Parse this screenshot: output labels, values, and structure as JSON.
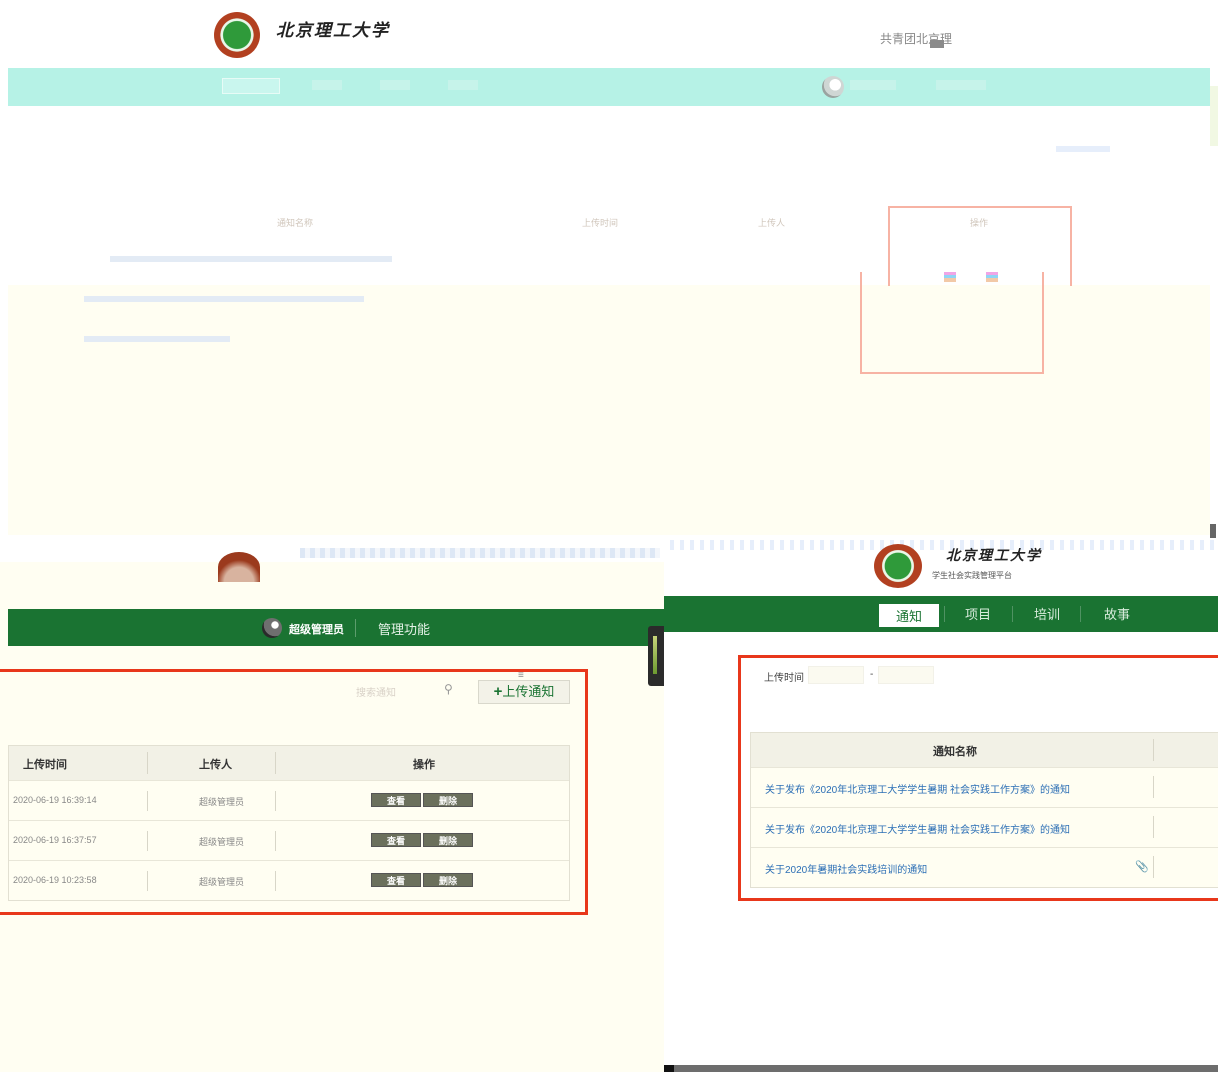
{
  "top_panel": {
    "brand_title": "北京理工大学",
    "org_text": "共青团北京理",
    "nav_items": [
      "通知",
      "项目",
      "培训",
      "故事"
    ],
    "table_headers": [
      "通知名称",
      "上传时间",
      "上传人",
      "操作"
    ]
  },
  "left_panel": {
    "user_name": "超级管理员",
    "admin_menu": "管理功能",
    "search_placeholder": "搜索通知",
    "upload_label": "上传通知",
    "table": {
      "headers": [
        "上传时间",
        "上传人",
        "操作"
      ],
      "rows": [
        {
          "time": "2020-06-19 16:39:14",
          "uploader": "超级管理员",
          "view": "查看",
          "delete": "删除"
        },
        {
          "time": "2020-06-19 16:37:57",
          "uploader": "超级管理员",
          "view": "查看",
          "delete": "删除"
        },
        {
          "time": "2020-06-19 10:23:58",
          "uploader": "超级管理员",
          "view": "查看",
          "delete": "删除"
        }
      ]
    }
  },
  "right_panel": {
    "brand_title": "北京理工大学",
    "brand_sub": "学生社会实践管理平台",
    "nav_tabs": [
      "通知",
      "项目",
      "培训",
      "故事"
    ],
    "active_tab": "通知",
    "filter_label": "上传时间",
    "date_separator": "-",
    "table_header": "通知名称",
    "rows": [
      {
        "title": "关于发布《2020年北京理工大学学生暑期 社会实践工作方案》的通知",
        "attachment": false
      },
      {
        "title": "关于发布《2020年北京理工大学学生暑期 社会实践工作方案》的通知",
        "attachment": false
      },
      {
        "title": "关于2020年暑期社会实践培训的通知",
        "attachment": true
      }
    ]
  },
  "icons": {
    "search": "search-icon",
    "attachment": "paperclip-icon",
    "add": "plus-icon"
  },
  "colors": {
    "nav_green": "#1a7332",
    "highlight_red": "#e8371b",
    "cream": "#fffef2",
    "link_blue": "#2c6fb5"
  }
}
